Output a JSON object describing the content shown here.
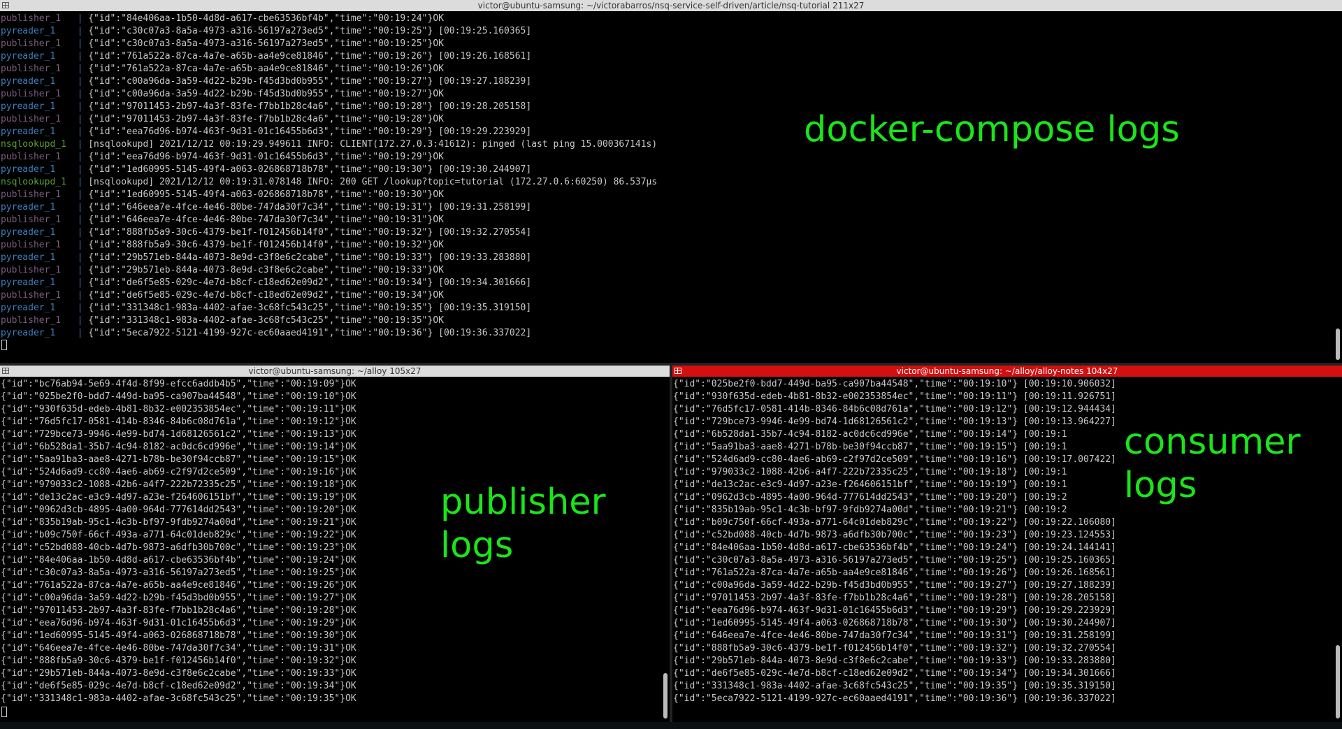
{
  "top": {
    "title": "victor@ubuntu-samsung: ~/victorabarros/nsq-service-self-driven/article/nsq-tutorial 211x27",
    "lines": [
      {
        "svc": "publisher_1",
        "text": "{\"id\":\"84e406aa-1b50-4d8d-a617-cbe63536bf4b\",\"time\":\"00:19:24\"}OK"
      },
      {
        "svc": "pyreader_1",
        "text": "{\"id\":\"c30c07a3-8a5a-4973-a316-56197a273ed5\",\"time\":\"00:19:25\"} [00:19:25.160365]"
      },
      {
        "svc": "publisher_1",
        "text": "{\"id\":\"c30c07a3-8a5a-4973-a316-56197a273ed5\",\"time\":\"00:19:25\"}OK"
      },
      {
        "svc": "pyreader_1",
        "text": "{\"id\":\"761a522a-87ca-4a7e-a65b-aa4e9ce81846\",\"time\":\"00:19:26\"} [00:19:26.168561]"
      },
      {
        "svc": "publisher_1",
        "text": "{\"id\":\"761a522a-87ca-4a7e-a65b-aa4e9ce81846\",\"time\":\"00:19:26\"}OK"
      },
      {
        "svc": "pyreader_1",
        "text": "{\"id\":\"c00a96da-3a59-4d22-b29b-f45d3bd0b955\",\"time\":\"00:19:27\"} [00:19:27.188239]"
      },
      {
        "svc": "publisher_1",
        "text": "{\"id\":\"c00a96da-3a59-4d22-b29b-f45d3bd0b955\",\"time\":\"00:19:27\"}OK"
      },
      {
        "svc": "pyreader_1",
        "text": "{\"id\":\"97011453-2b97-4a3f-83fe-f7bb1b28c4a6\",\"time\":\"00:19:28\"} [00:19:28.205158]"
      },
      {
        "svc": "publisher_1",
        "text": "{\"id\":\"97011453-2b97-4a3f-83fe-f7bb1b28c4a6\",\"time\":\"00:19:28\"}OK"
      },
      {
        "svc": "pyreader_1",
        "text": "{\"id\":\"eea76d96-b974-463f-9d31-01c16455b6d3\",\"time\":\"00:19:29\"} [00:19:29.223929]"
      },
      {
        "svc": "nsqlookupd_1",
        "text": "[nsqlookupd] 2021/12/12 00:19:29.949611 INFO: CLIENT(172.27.0.3:41612): pinged (last ping 15.000367141s)"
      },
      {
        "svc": "publisher_1",
        "text": "{\"id\":\"eea76d96-b974-463f-9d31-01c16455b6d3\",\"time\":\"00:19:29\"}OK"
      },
      {
        "svc": "pyreader_1",
        "text": "{\"id\":\"1ed60995-5145-49f4-a063-026868718b78\",\"time\":\"00:19:30\"} [00:19:30.244907]"
      },
      {
        "svc": "nsqlookupd_1",
        "text": "[nsqlookupd] 2021/12/12 00:19:31.078148 INFO: 200 GET /lookup?topic=tutorial (172.27.0.6:60250) 86.537μs"
      },
      {
        "svc": "publisher_1",
        "text": "{\"id\":\"1ed60995-5145-49f4-a063-026868718b78\",\"time\":\"00:19:30\"}OK"
      },
      {
        "svc": "pyreader_1",
        "text": "{\"id\":\"646eea7e-4fce-4e46-80be-747da30f7c34\",\"time\":\"00:19:31\"} [00:19:31.258199]"
      },
      {
        "svc": "publisher_1",
        "text": "{\"id\":\"646eea7e-4fce-4e46-80be-747da30f7c34\",\"time\":\"00:19:31\"}OK"
      },
      {
        "svc": "pyreader_1",
        "text": "{\"id\":\"888fb5a9-30c6-4379-be1f-f012456b14f0\",\"time\":\"00:19:32\"} [00:19:32.270554]"
      },
      {
        "svc": "publisher_1",
        "text": "{\"id\":\"888fb5a9-30c6-4379-be1f-f012456b14f0\",\"time\":\"00:19:32\"}OK"
      },
      {
        "svc": "pyreader_1",
        "text": "{\"id\":\"29b571eb-844a-4073-8e9d-c3f8e6c2cabe\",\"time\":\"00:19:33\"} [00:19:33.283880]"
      },
      {
        "svc": "publisher_1",
        "text": "{\"id\":\"29b571eb-844a-4073-8e9d-c3f8e6c2cabe\",\"time\":\"00:19:33\"}OK"
      },
      {
        "svc": "pyreader_1",
        "text": "{\"id\":\"de6f5e85-029c-4e7d-b8cf-c18ed62e09d2\",\"time\":\"00:19:34\"} [00:19:34.301666]"
      },
      {
        "svc": "publisher_1",
        "text": "{\"id\":\"de6f5e85-029c-4e7d-b8cf-c18ed62e09d2\",\"time\":\"00:19:34\"}OK"
      },
      {
        "svc": "pyreader_1",
        "text": "{\"id\":\"331348c1-983a-4402-afae-3c68fc543c25\",\"time\":\"00:19:35\"} [00:19:35.319150]"
      },
      {
        "svc": "publisher_1",
        "text": "{\"id\":\"331348c1-983a-4402-afae-3c68fc543c25\",\"time\":\"00:19:35\"}OK"
      },
      {
        "svc": "pyreader_1",
        "text": "{\"id\":\"5eca7922-5121-4199-927c-ec60aaed4191\",\"time\":\"00:19:36\"} [00:19:36.337022]"
      }
    ],
    "annotation": "docker-compose logs"
  },
  "left": {
    "title": "victor@ubuntu-samsung: ~/alloy 105x27",
    "lines": [
      "{\"id\":\"bc76ab94-5e69-4f4d-8f99-efcc6addb4b5\",\"time\":\"00:19:09\"}OK",
      "{\"id\":\"025be2f0-bdd7-449d-ba95-ca907ba44548\",\"time\":\"00:19:10\"}OK",
      "{\"id\":\"930f635d-edeb-4b81-8b32-e002353854ec\",\"time\":\"00:19:11\"}OK",
      "{\"id\":\"76d5fc17-0581-414b-8346-84b6c08d761a\",\"time\":\"00:19:12\"}OK",
      "{\"id\":\"729bce73-9946-4e99-bd74-1d68126561c2\",\"time\":\"00:19:13\"}OK",
      "{\"id\":\"6b528da1-35b7-4c94-8182-ac0dc6cd996e\",\"time\":\"00:19:14\"}OK",
      "{\"id\":\"5aa91ba3-aae8-4271-b78b-be30f94ccb87\",\"time\":\"00:19:15\"}OK",
      "{\"id\":\"524d6ad9-cc80-4ae6-ab69-c2f97d2ce509\",\"time\":\"00:19:16\"}OK",
      "{\"id\":\"979033c2-1088-42b6-a4f7-222b72335c25\",\"time\":\"00:19:18\"}OK",
      "{\"id\":\"de13c2ac-e3c9-4d97-a23e-f264606151bf\",\"time\":\"00:19:19\"}OK",
      "{\"id\":\"0962d3cb-4895-4a00-964d-777614dd2543\",\"time\":\"00:19:20\"}OK",
      "{\"id\":\"835b19ab-95c1-4c3b-bf97-9fdb9274a00d\",\"time\":\"00:19:21\"}OK",
      "{\"id\":\"b09c750f-66cf-493a-a771-64c01deb829c\",\"time\":\"00:19:22\"}OK",
      "{\"id\":\"c52bd088-40cb-4d7b-9873-a6dfb30b700c\",\"time\":\"00:19:23\"}OK",
      "{\"id\":\"84e406aa-1b50-4d8d-a617-cbe63536bf4b\",\"time\":\"00:19:24\"}OK",
      "{\"id\":\"c30c07a3-8a5a-4973-a316-56197a273ed5\",\"time\":\"00:19:25\"}OK",
      "{\"id\":\"761a522a-87ca-4a7e-a65b-aa4e9ce81846\",\"time\":\"00:19:26\"}OK",
      "{\"id\":\"c00a96da-3a59-4d22-b29b-f45d3bd0b955\",\"time\":\"00:19:27\"}OK",
      "{\"id\":\"97011453-2b97-4a3f-83fe-f7bb1b28c4a6\",\"time\":\"00:19:28\"}OK",
      "{\"id\":\"eea76d96-b974-463f-9d31-01c16455b6d3\",\"time\":\"00:19:29\"}OK",
      "{\"id\":\"1ed60995-5145-49f4-a063-026868718b78\",\"time\":\"00:19:30\"}OK",
      "{\"id\":\"646eea7e-4fce-4e46-80be-747da30f7c34\",\"time\":\"00:19:31\"}OK",
      "{\"id\":\"888fb5a9-30c6-4379-be1f-f012456b14f0\",\"time\":\"00:19:32\"}OK",
      "{\"id\":\"29b571eb-844a-4073-8e9d-c3f8e6c2cabe\",\"time\":\"00:19:33\"}OK",
      "{\"id\":\"de6f5e85-029c-4e7d-b8cf-c18ed62e09d2\",\"time\":\"00:19:34\"}OK",
      "{\"id\":\"331348c1-983a-4402-afae-3c68fc543c25\",\"time\":\"00:19:35\"}OK"
    ],
    "annotation_line1": "publisher",
    "annotation_line2": "logs"
  },
  "right": {
    "title": "victor@ubuntu-samsung: ~/alloy/alloy-notes 104x27",
    "lines": [
      "{\"id\":\"025be2f0-bdd7-449d-ba95-ca907ba44548\",\"time\":\"00:19:10\"} [00:19:10.906032]",
      "{\"id\":\"930f635d-edeb-4b81-8b32-e002353854ec\",\"time\":\"00:19:11\"} [00:19:11.926751]",
      "{\"id\":\"76d5fc17-0581-414b-8346-84b6c08d761a\",\"time\":\"00:19:12\"} [00:19:12.944434]",
      "{\"id\":\"729bce73-9946-4e99-bd74-1d68126561c2\",\"time\":\"00:19:13\"} [00:19:13.964227]",
      "{\"id\":\"6b528da1-35b7-4c94-8182-ac0dc6cd996e\",\"time\":\"00:19:14\"} [00:19:1",
      "{\"id\":\"5aa91ba3-aae8-4271-b78b-be30f94ccb87\",\"time\":\"00:19:15\"} [00:19:1",
      "{\"id\":\"524d6ad9-cc80-4ae6-ab69-c2f97d2ce509\",\"time\":\"00:19:16\"} [00:19:17.007422]",
      "{\"id\":\"979033c2-1088-42b6-a4f7-222b72335c25\",\"time\":\"00:19:18\"} [00:19:1",
      "{\"id\":\"de13c2ac-e3c9-4d97-a23e-f264606151bf\",\"time\":\"00:19:19\"} [00:19:1",
      "{\"id\":\"0962d3cb-4895-4a00-964d-777614dd2543\",\"time\":\"00:19:20\"} [00:19:2",
      "{\"id\":\"835b19ab-95c1-4c3b-bf97-9fdb9274a00d\",\"time\":\"00:19:21\"} [00:19:2",
      "{\"id\":\"b09c750f-66cf-493a-a771-64c01deb829c\",\"time\":\"00:19:22\"} [00:19:22.106080]",
      "{\"id\":\"c52bd088-40cb-4d7b-9873-a6dfb30b700c\",\"time\":\"00:19:23\"} [00:19:23.124553]",
      "{\"id\":\"84e406aa-1b50-4d8d-a617-cbe63536bf4b\",\"time\":\"00:19:24\"} [00:19:24.144141]",
      "{\"id\":\"c30c07a3-8a5a-4973-a316-56197a273ed5\",\"time\":\"00:19:25\"} [00:19:25.160365]",
      "{\"id\":\"761a522a-87ca-4a7e-a65b-aa4e9ce81846\",\"time\":\"00:19:26\"} [00:19:26.168561]",
      "{\"id\":\"c00a96da-3a59-4d22-b29b-f45d3bd0b955\",\"time\":\"00:19:27\"} [00:19:27.188239]",
      "{\"id\":\"97011453-2b97-4a3f-83fe-f7bb1b28c4a6\",\"time\":\"00:19:28\"} [00:19:28.205158]",
      "{\"id\":\"eea76d96-b974-463f-9d31-01c16455b6d3\",\"time\":\"00:19:29\"} [00:19:29.223929]",
      "{\"id\":\"1ed60995-5145-49f4-a063-026868718b78\",\"time\":\"00:19:30\"} [00:19:30.244907]",
      "{\"id\":\"646eea7e-4fce-4e46-80be-747da30f7c34\",\"time\":\"00:19:31\"} [00:19:31.258199]",
      "{\"id\":\"888fb5a9-30c6-4379-be1f-f012456b14f0\",\"time\":\"00:19:32\"} [00:19:32.270554]",
      "{\"id\":\"29b571eb-844a-4073-8e9d-c3f8e6c2cabe\",\"time\":\"00:19:33\"} [00:19:33.283880]",
      "{\"id\":\"de6f5e85-029c-4e7d-b8cf-c18ed62e09d2\",\"time\":\"00:19:34\"} [00:19:34.301666]",
      "{\"id\":\"331348c1-983a-4402-afae-3c68fc543c25\",\"time\":\"00:19:35\"} [00:19:35.319150]",
      "{\"id\":\"5eca7922-5121-4199-927c-ec60aaed4191\",\"time\":\"00:19:36\"} [00:19:36.337022]"
    ],
    "annotation_line1": "consumer",
    "annotation_line2": "logs"
  },
  "colors": {
    "annotation": "#19e619",
    "active_titlebar": "#d40f0f",
    "publisher_prefix": "#7a5c7c",
    "pyreader_prefix": "#3a7fbf",
    "nsqlookupd_prefix": "#5aa02c"
  },
  "icons": [
    "terminal-window-icon"
  ]
}
